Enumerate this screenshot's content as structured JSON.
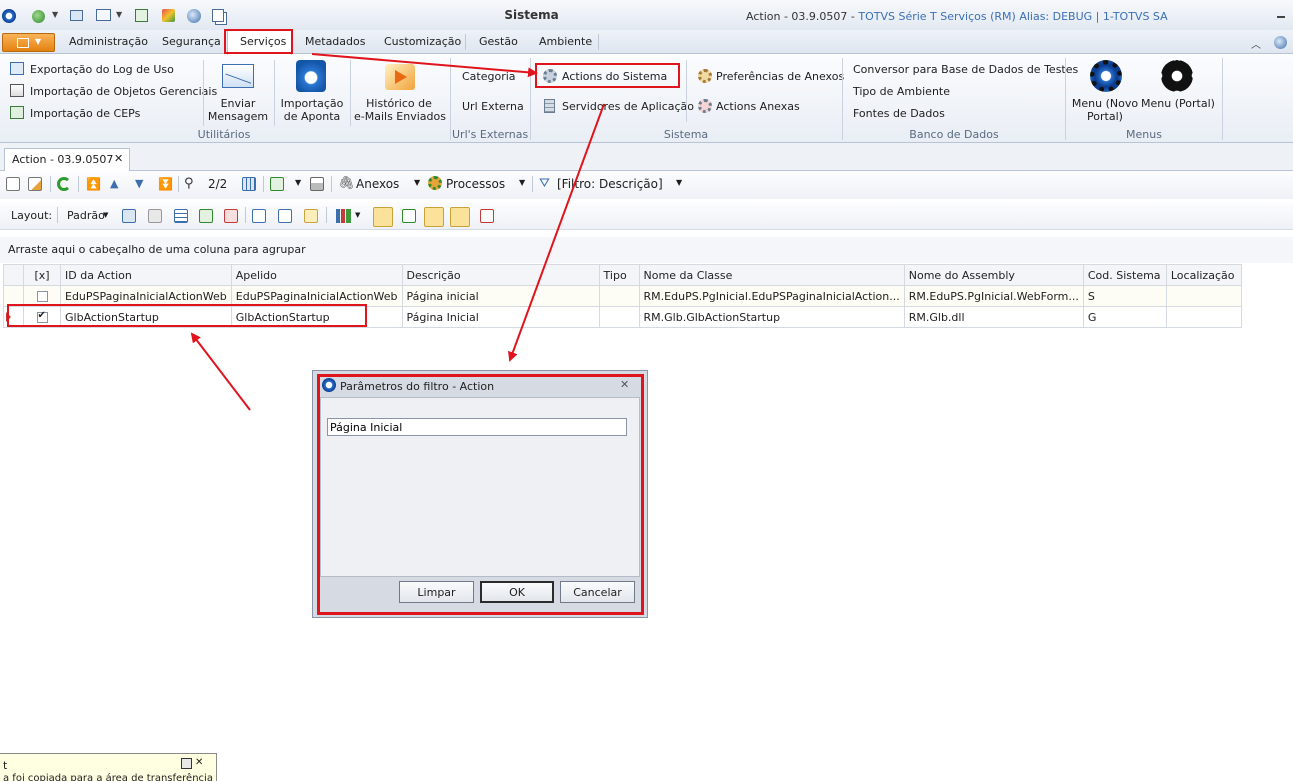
{
  "window": {
    "title": "Sistema",
    "subtitle_prefix": "Action - 03.9.0507 - ",
    "subtitle_highlight": "TOTVS Série T Serviços (RM) Alias: DEBUG | 1-TOTVS SA"
  },
  "menu_tabs": [
    "Administração",
    "Segurança",
    "Serviços",
    "Metadados",
    "Customização",
    "Gestão",
    "Ambiente"
  ],
  "ribbon": {
    "utilitarios": {
      "label": "Utilitários",
      "small_items": [
        "Exportação do Log de Uso",
        "Importação de Objetos Gerenciais",
        "Importação de CEPs"
      ],
      "big_items": [
        {
          "line1": "Enviar",
          "line2": "Mensagem"
        },
        {
          "line1": "Importação",
          "line2": "de Aponta"
        },
        {
          "line1": "Histórico de",
          "line2": "e-Mails Enviados"
        }
      ]
    },
    "url_externas": {
      "label": "Url's Externas",
      "items": [
        "Categoria",
        "Url Externa"
      ]
    },
    "sistema": {
      "label": "Sistema",
      "items": [
        "Actions do Sistema",
        "Servidores de Aplicação",
        "Preferências de Anexos",
        "Actions Anexas"
      ]
    },
    "banco": {
      "label": "Banco de Dados",
      "items": [
        "Conversor para Base de Dados de Testes",
        "Tipo de Ambiente",
        "Fontes de Dados"
      ]
    },
    "menus": {
      "label": "Menus",
      "items": [
        {
          "line1": "Menu (Novo",
          "line2": "Portal)"
        },
        {
          "line1": "Menu (Portal)",
          "line2": ""
        }
      ]
    }
  },
  "doc_tab": {
    "label": "Action - 03.9.0507",
    "close": "✕"
  },
  "toolbar1": {
    "pager": "2/2",
    "anexos": "Anexos",
    "processos": "Processos",
    "filtro": "[Filtro: Descrição]"
  },
  "toolbar2": {
    "layout_label": "Layout:",
    "padrao": "Padrão"
  },
  "group_hint": "Arraste aqui o cabeçalho de uma coluna para agrupar",
  "grid": {
    "columns": [
      "[x]",
      "ID da Action",
      "Apelido",
      "Descrição",
      "Tipo",
      "Nome da Classe",
      "Nome do Assembly",
      "Cod. Sistema",
      "Localização"
    ],
    "rows": [
      {
        "checked": false,
        "id": "EduPSPaginaInicialActionWeb",
        "apelido": "EduPSPaginaInicialActionWeb",
        "descricao": "Página inicial",
        "tipo": "",
        "classe": "RM.EduPS.PgInicial.EduPSPaginaInicialAction...",
        "assembly": "RM.EduPS.PgInicial.WebForm...",
        "cod": "S",
        "local": ""
      },
      {
        "checked": true,
        "id": "GlbActionStartup",
        "apelido": "GlbActionStartup",
        "descricao": "Página Inicial",
        "tipo": "",
        "classe": "RM.Glb.GlbActionStartup",
        "assembly": "RM.Glb.dll",
        "cod": "G",
        "local": ""
      }
    ]
  },
  "dialog": {
    "title": "Parâmetros do filtro - Action",
    "input_value": "Página Inicial",
    "buttons": {
      "clear": "Limpar",
      "ok": "OK",
      "cancel": "Cancelar"
    }
  },
  "notification": {
    "line1": "t",
    "line2": "a foi copiada para a área de transferência"
  },
  "colors": {
    "highlight_red": "#e0141c",
    "accent_blue": "#3b6fb6",
    "file_orange": "#f39c33"
  }
}
